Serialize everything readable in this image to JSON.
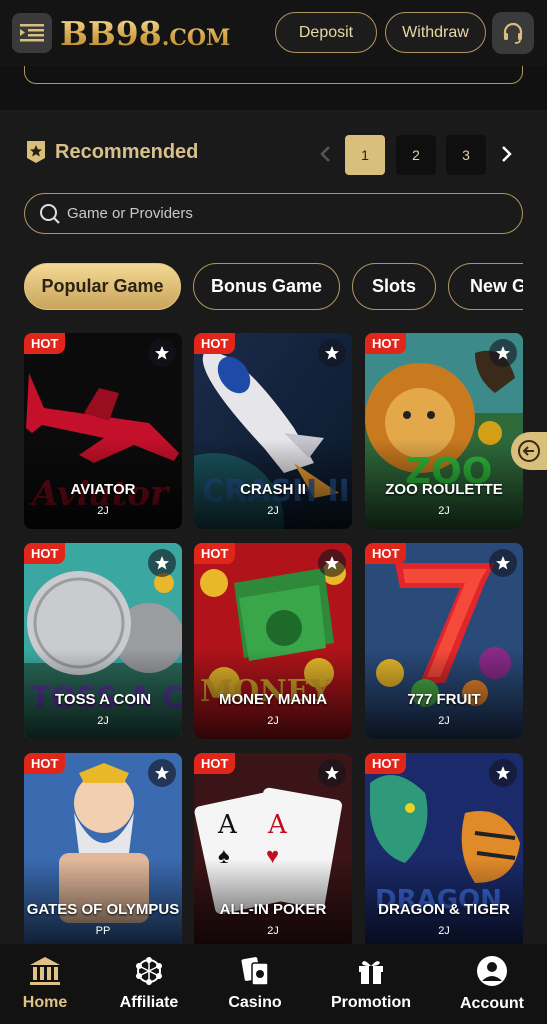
{
  "header": {
    "logo_main": "BB98",
    "logo_suffix": ".COM",
    "deposit_label": "Deposit",
    "withdraw_label": "Withdraw"
  },
  "recommended": {
    "title": "Recommended",
    "pages": [
      "1",
      "2",
      "3"
    ],
    "active_page": "1"
  },
  "search": {
    "placeholder": "Game or Providers"
  },
  "tabs": [
    {
      "label": "Popular Game",
      "active": true
    },
    {
      "label": "Bonus Game",
      "active": false
    },
    {
      "label": "Slots",
      "active": false
    },
    {
      "label": "New G",
      "active": false
    }
  ],
  "games": [
    {
      "name": "AVIATOR",
      "provider": "2J",
      "badge": "HOT"
    },
    {
      "name": "CRASH II",
      "provider": "2J",
      "badge": "HOT"
    },
    {
      "name": "ZOO ROULETTE",
      "provider": "2J",
      "badge": "HOT"
    },
    {
      "name": "TOSS A COIN",
      "provider": "2J",
      "badge": "HOT"
    },
    {
      "name": "MONEY MANIA",
      "provider": "2J",
      "badge": "HOT"
    },
    {
      "name": "777 FRUIT",
      "provider": "2J",
      "badge": "HOT"
    },
    {
      "name": "GATES OF OLYMPUS",
      "provider": "PP",
      "badge": "HOT"
    },
    {
      "name": "ALL-IN POKER",
      "provider": "2J",
      "badge": "HOT"
    },
    {
      "name": "DRAGON & TIGER",
      "provider": "2J",
      "badge": "HOT"
    }
  ],
  "bottom_nav": [
    {
      "label": "Home",
      "icon": "bank-icon",
      "active": true
    },
    {
      "label": "Affiliate",
      "icon": "network-icon",
      "active": false
    },
    {
      "label": "Casino",
      "icon": "cards-icon",
      "active": false
    },
    {
      "label": "Promotion",
      "icon": "gift-icon",
      "active": false
    },
    {
      "label": "Account",
      "icon": "user-icon",
      "active": false
    }
  ],
  "colors": {
    "gold": "#d9bf7c",
    "hot_badge": "#e0261b",
    "background": "#1a1a1a"
  }
}
